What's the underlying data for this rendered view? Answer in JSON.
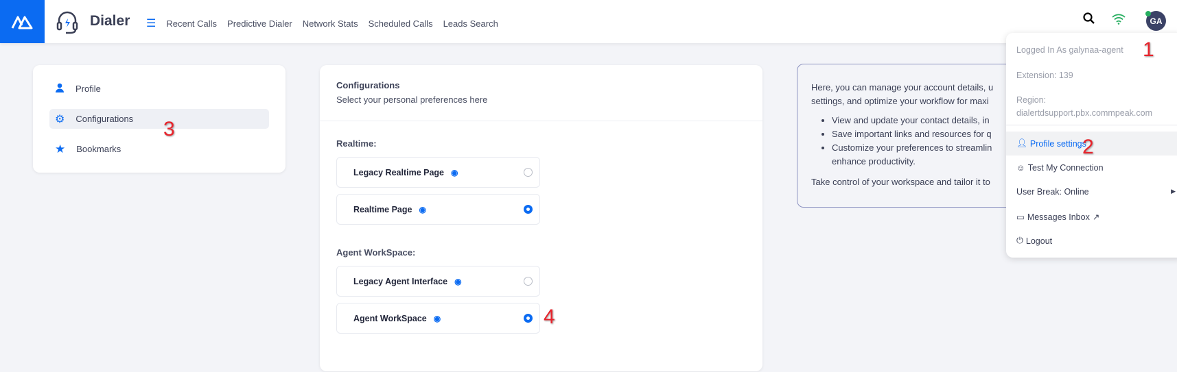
{
  "header": {
    "app_title": "Dialer",
    "nav": [
      "Recent Calls",
      "Predictive Dialer",
      "Network Stats",
      "Scheduled Calls",
      "Leads Search"
    ],
    "avatar_initials": "GA"
  },
  "sidebar": {
    "items": [
      {
        "label": "Profile"
      },
      {
        "label": "Configurations"
      },
      {
        "label": "Bookmarks"
      }
    ]
  },
  "config": {
    "title": "Configurations",
    "subtitle": "Select your personal preferences here",
    "sections": [
      {
        "label": "Realtime:",
        "options": [
          {
            "label": "Legacy Realtime Page",
            "selected": false
          },
          {
            "label": "Realtime Page",
            "selected": true
          }
        ]
      },
      {
        "label": "Agent WorkSpace:",
        "options": [
          {
            "label": "Legacy Agent Interface",
            "selected": false
          },
          {
            "label": "Agent WorkSpace",
            "selected": true
          }
        ]
      }
    ]
  },
  "info": {
    "line1": "Here, you can manage your account details, u",
    "line2": "settings, and optimize your workflow for maxi",
    "bullets": [
      "View and update your contact details, in",
      "Save important links and resources for q",
      "Customize your preferences to streamlin"
    ],
    "bullet3_cont": "enhance productivity.",
    "footer": "Take control of your workspace and tailor it to"
  },
  "dropdown": {
    "logged_in": "Logged In As galynaa-agent",
    "extension": "Extension: 139",
    "region_label": "Region:",
    "region_value": "dialertdsupport.pbx.commpeak.com",
    "items": [
      "Profile settings",
      "Test My Connection",
      "User Break: Online",
      "Messages Inbox",
      "Logout"
    ]
  },
  "annotations": [
    "1",
    "2",
    "3",
    "4"
  ],
  "colors": {
    "accent": "#0b6bf2",
    "online": "#27ae60",
    "annotation": "#e8232b"
  }
}
